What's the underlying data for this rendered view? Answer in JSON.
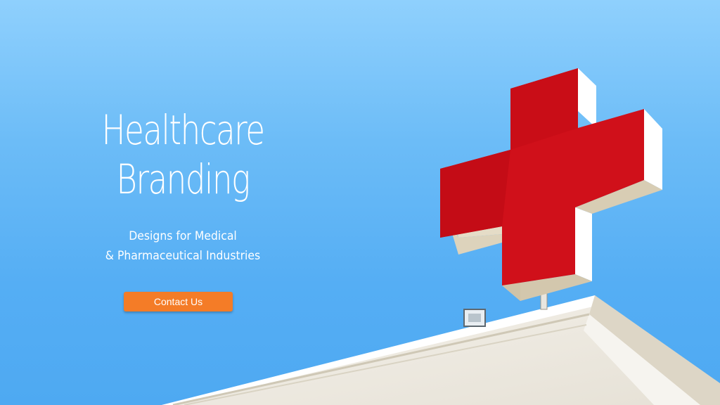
{
  "hero": {
    "title_line1": "Healthcare",
    "title_line2": "Branding",
    "subtitle_line1": "Designs for Medical",
    "subtitle_line2": "& Pharmaceutical Industries",
    "cta_label": "Contact Us"
  },
  "colors": {
    "sky_top": "#8fd0fd",
    "sky_bottom": "#4ea9f2",
    "cross_red": "#d0101a",
    "cta_orange": "#f47c27",
    "text": "#ffffff"
  },
  "image": {
    "subject": "red-cross-sign-on-building-roof"
  }
}
